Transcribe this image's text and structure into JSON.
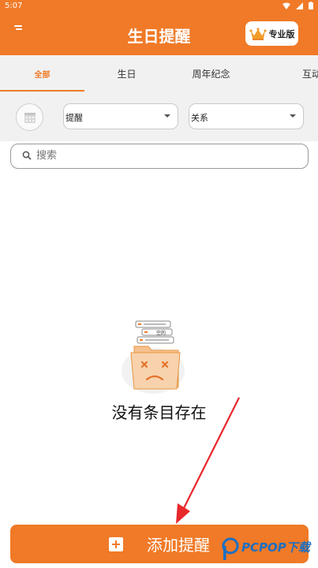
{
  "status_bar": {
    "time": "5:07"
  },
  "header": {
    "title": "生日提醒",
    "pro_label": "专业版"
  },
  "tabs": [
    {
      "label": "全部",
      "active": true
    },
    {
      "label": "生日",
      "active": false
    },
    {
      "label": "周年纪念",
      "active": false
    },
    {
      "label": "互动",
      "active": false
    }
  ],
  "filters": {
    "type_select": "提醒",
    "relation_select": "关系"
  },
  "search": {
    "placeholder": "搜索"
  },
  "empty_state": {
    "illustration_label": "空的",
    "message": "没有条目存在"
  },
  "add_button": {
    "label": "添加提醒"
  },
  "watermark": {
    "text": "PCPOP下载"
  },
  "colors": {
    "accent": "#f07a27",
    "background": "#f1f1f1",
    "arrow": "#e8282b"
  }
}
